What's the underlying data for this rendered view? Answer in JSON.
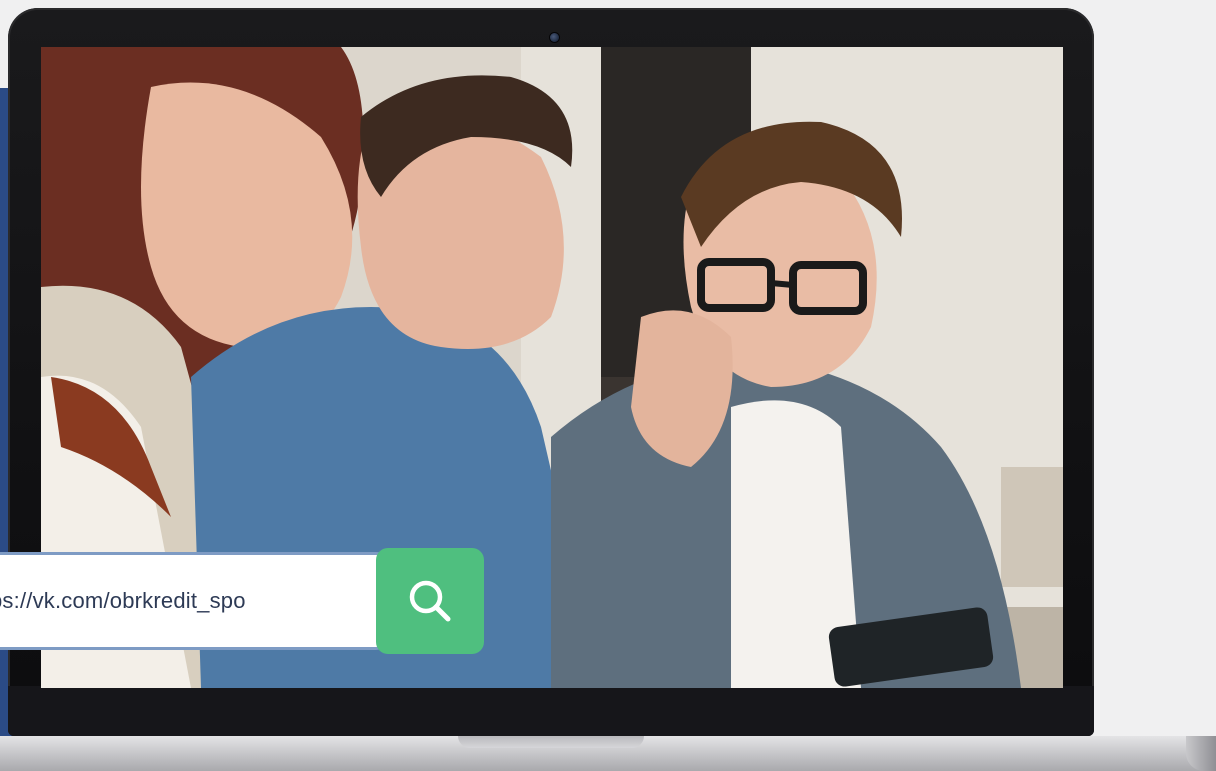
{
  "search": {
    "value": "ps://vk.com/obrkredit_spo",
    "button_icon": "search-icon"
  },
  "colors": {
    "accent_green": "#4fbf7f",
    "panel_blue": "#2b4b86",
    "input_border": "#7e9bc4",
    "laptop_frame": "#111113"
  },
  "photo": {
    "icon": "photo-of-three-people-looking-at-phone"
  }
}
